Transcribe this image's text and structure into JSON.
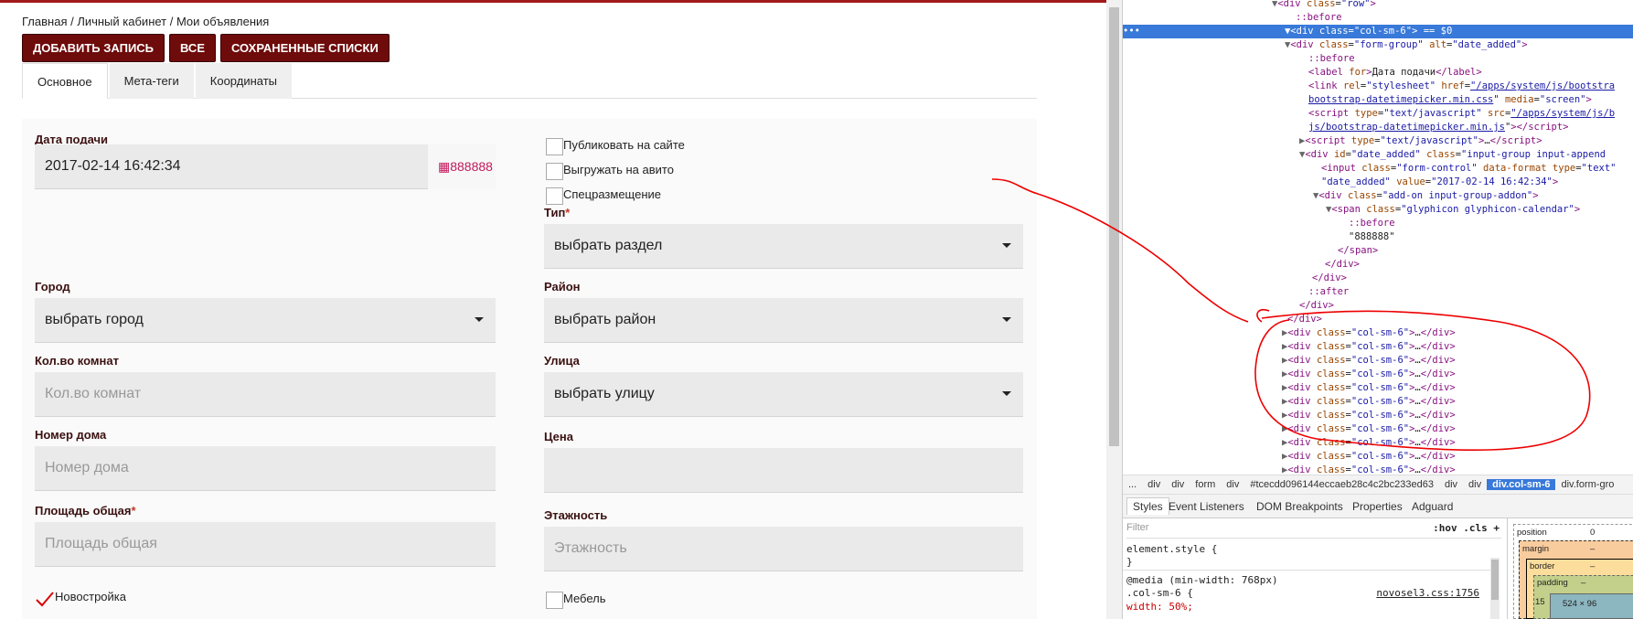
{
  "breadcrumb": "Главная / Личный кабинет / Мои объявления",
  "buttons": {
    "add": "ДОБАВИТЬ ЗАПИСЬ",
    "all": "ВСЕ",
    "saved": "СОХРАНЕННЫЕ СПИСКИ"
  },
  "tabs": {
    "main": "Основное",
    "meta": "Мета-теги",
    "coords": "Координаты"
  },
  "form": {
    "date_label": "Дата подачи",
    "date_value": "2017-02-14 16:42:34",
    "date_addon": "888888",
    "publish": "Публиковать на сайте",
    "avito": "Выгружать на авито",
    "special": "Спецразмещение",
    "type_label": "Тип",
    "type_value": "выбрать раздел",
    "city_label": "Город",
    "city_value": "выбрать город",
    "district_label": "Район",
    "district_value": "выбрать район",
    "rooms_label": "Кол.во комнат",
    "rooms_placeholder": "Кол.во комнат",
    "street_label": "Улица",
    "street_value": "выбрать улицу",
    "house_label": "Номер дома",
    "house_placeholder": "Номер дома",
    "price_label": "Цена",
    "area_label": "Площадь общая",
    "area_placeholder": "Площадь общая",
    "floor_label": "Этажность",
    "floor_placeholder": "Этажность",
    "newbuild": "Новостройка",
    "furniture": "Мебель",
    "required_mark": "*"
  },
  "devtools": {
    "crumbs": [
      "...",
      "div",
      "div",
      "form",
      "div",
      "#tcecdd096144eccaeb28c4c2bc233ed63",
      "div",
      "div",
      "div.col-sm-6",
      "div.form-gro"
    ],
    "style_tabs": [
      "Styles",
      "Event Listeners",
      "DOM Breakpoints",
      "Properties",
      "Adguard"
    ],
    "filter_placeholder": "Filter",
    "hov_cls": ":hov  .cls  +",
    "styles_lines": [
      "element.style {",
      "}",
      "@media (min-width: 768px)",
      ".col-sm-6 {",
      "  width: 50%;"
    ],
    "styles_ref": "novosel3.css:1756",
    "box_labels": {
      "position": "position",
      "position_val": "0",
      "margin": "margin",
      "margin_val": "–",
      "border": "border",
      "border_val": "–",
      "padding": "padding",
      "padding_val": "–",
      "left": "15",
      "content": "524 × 96"
    }
  }
}
